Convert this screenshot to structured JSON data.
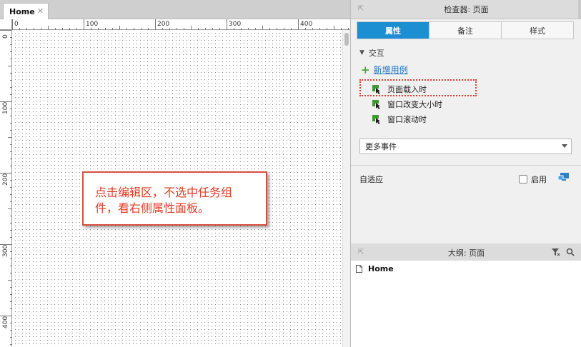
{
  "canvas_tab": {
    "label": "Home",
    "close": "✕"
  },
  "ruler": {
    "top_labels": [
      "0",
      "100",
      "200",
      "300",
      "400"
    ],
    "left_labels": [
      "0",
      "100",
      "200",
      "300",
      "400"
    ]
  },
  "callout": {
    "text": "点击编辑区，不选中任务组件，看右侧属性面板。"
  },
  "inspector": {
    "title": "检查器: 页面",
    "tabs": [
      {
        "label": "属性",
        "active": true
      },
      {
        "label": "备注",
        "active": false
      },
      {
        "label": "样式",
        "active": false
      }
    ],
    "interaction_section": "交互",
    "add_case_link": "新增用例",
    "events": [
      {
        "label": "页面载入时",
        "icon": "cursor-event-icon"
      },
      {
        "label": "窗口改变大小时",
        "icon": "cursor-event-icon"
      },
      {
        "label": "窗口滚动时",
        "icon": "cursor-event-icon"
      }
    ],
    "more_events": "更多事件",
    "adaptive_label": "自适应",
    "enable_label": "启用"
  },
  "outline": {
    "title": "大纲: 页面",
    "items": [
      {
        "label": "Home",
        "icon": "page-icon"
      }
    ]
  },
  "colors": {
    "accent_tab": "#1b8fd2",
    "link": "#1a70c2",
    "callout_border": "#d9503f",
    "callout_text": "#e03a24",
    "event_icon_green": "#3c9a2e"
  }
}
